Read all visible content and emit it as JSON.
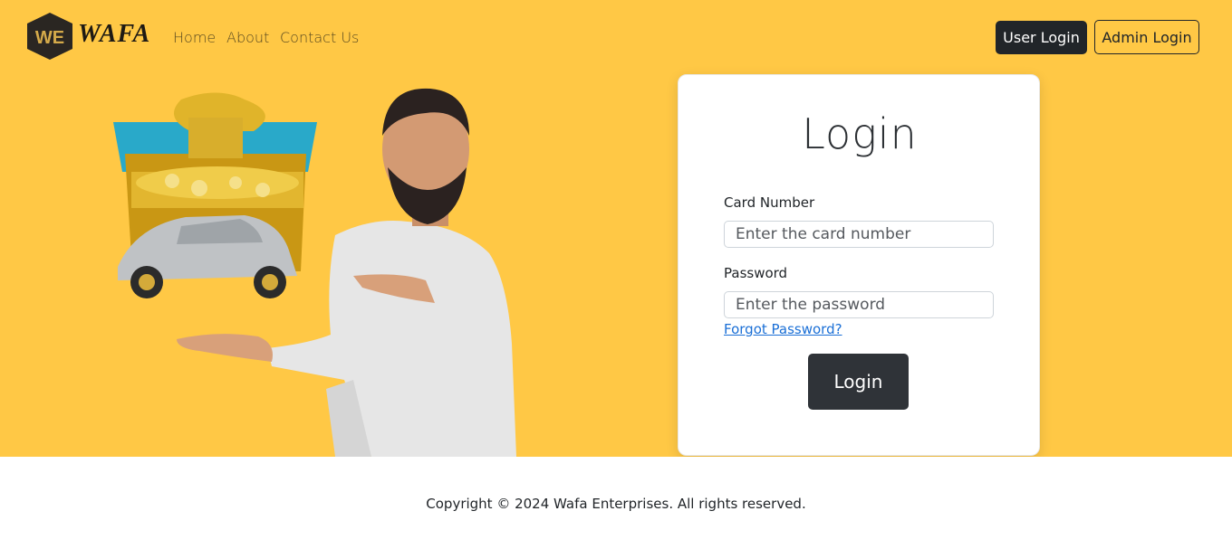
{
  "brand": {
    "name": "WAFA",
    "mark": "WE"
  },
  "nav": {
    "links": [
      "Home",
      "About",
      "Contact Us"
    ],
    "user_login": "User Login",
    "admin_login": "Admin Login"
  },
  "login": {
    "title": "Login",
    "card_label": "Card Number",
    "card_placeholder": "Enter the card number",
    "password_label": "Password",
    "password_placeholder": "Enter the password",
    "forgot": "Forgot Password?",
    "submit": "Login"
  },
  "footer": {
    "text": "Copyright © 2024 Wafa Enterprises. All rights reserved."
  },
  "colors": {
    "hero_bg": "#ffc845",
    "dark": "#212529",
    "link": "#1a6fd6"
  }
}
